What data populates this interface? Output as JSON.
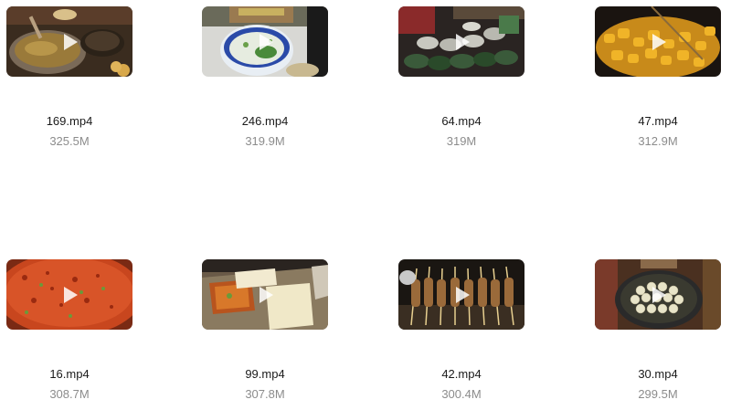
{
  "files": [
    {
      "name": "169.mp4",
      "size": "325.5M",
      "thumb": "soup-pot"
    },
    {
      "name": "246.mp4",
      "size": "319.9M",
      "thumb": "noodle-bowl"
    },
    {
      "name": "64.mp4",
      "size": "319M",
      "thumb": "food-cans"
    },
    {
      "name": "47.mp4",
      "size": "312.9M",
      "thumb": "fried-potatoes"
    },
    {
      "name": "16.mp4",
      "size": "308.7M",
      "thumb": "flatbread"
    },
    {
      "name": "99.mp4",
      "size": "307.8M",
      "thumb": "tofu-griddle"
    },
    {
      "name": "42.mp4",
      "size": "300.4M",
      "thumb": "skewers"
    },
    {
      "name": "30.mp4",
      "size": "299.5M",
      "thumb": "dumpling-pan"
    }
  ],
  "icons": {
    "play": "play-icon"
  },
  "colors": {
    "filename": "#1a1a1a",
    "filesize": "#8c8c8c"
  }
}
